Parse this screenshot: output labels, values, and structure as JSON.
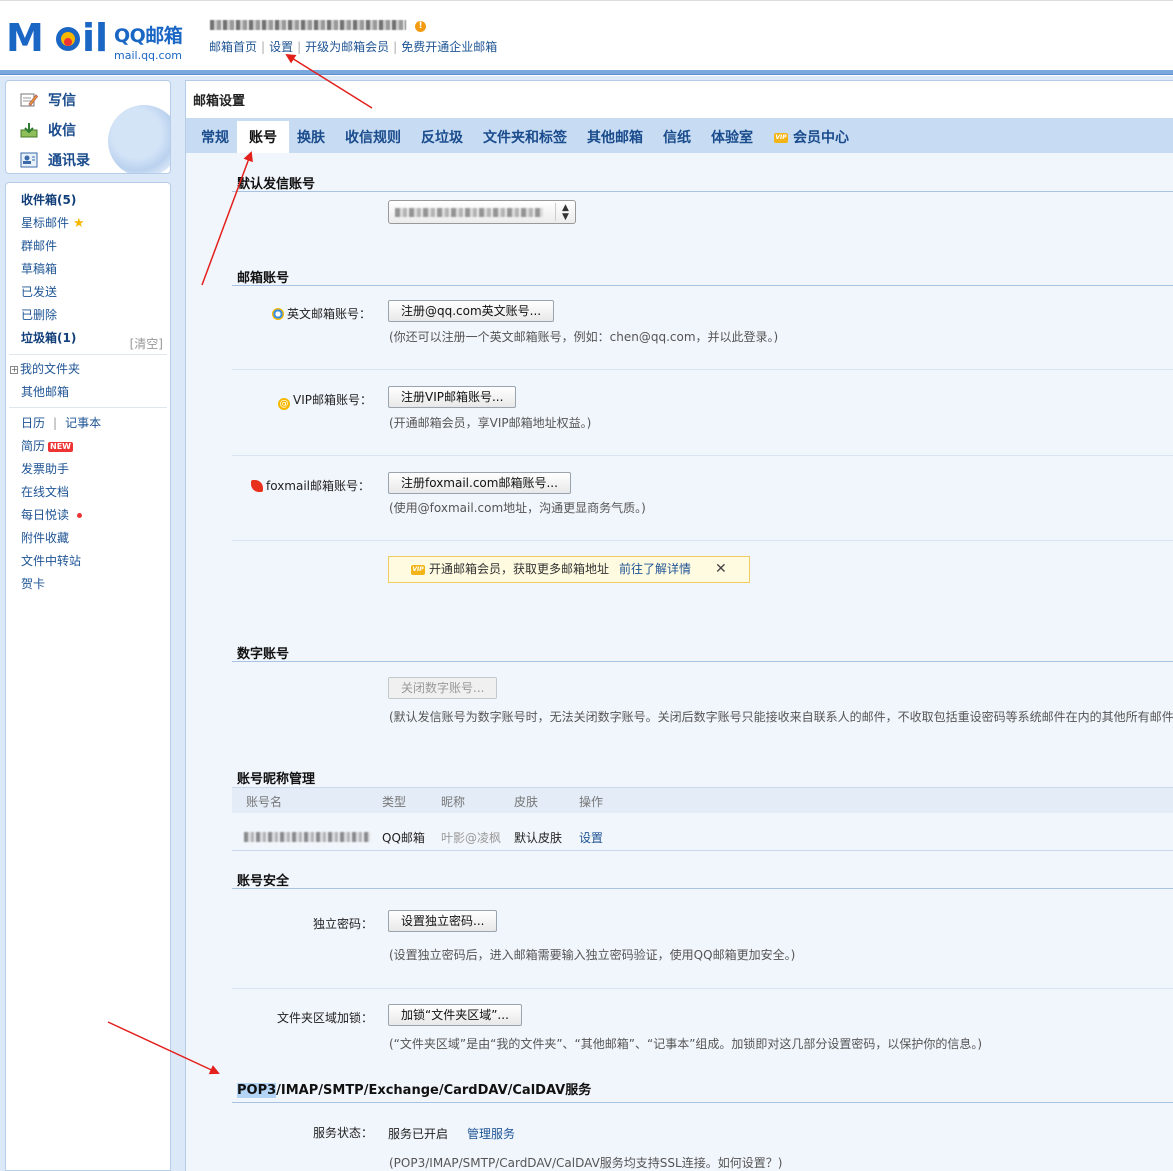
{
  "header": {
    "logo_text": "M●il",
    "logo_cn": "QQ邮箱",
    "logo_en": "mail.qq.com",
    "warn_icon": "!",
    "links": [
      "邮箱首页",
      "设置",
      "开级为邮箱会员",
      "免费开通企业邮箱"
    ]
  },
  "compose": {
    "write": "写信",
    "receive": "收信",
    "contacts": "通讯录"
  },
  "folders": {
    "inbox": "收件箱(5)",
    "starred": "星标邮件",
    "group": "群邮件",
    "drafts": "草稿箱",
    "sent": "已发送",
    "deleted": "已删除",
    "spam": "垃圾箱(1)",
    "spam_clear": "[清空]",
    "my_folders": "我的文件夹",
    "other_mailbox": "其他邮箱",
    "calendar": "日历",
    "notes": "记事本",
    "resume": "简历",
    "new_badge": "NEW",
    "invoice": "发票助手",
    "online_docs": "在线文档",
    "daily_read": "每日悦读",
    "attachments": "附件收藏",
    "file_transfer": "文件中转站",
    "greeting_card": "贺卡"
  },
  "main": {
    "title": "邮箱设置",
    "tabs": [
      "常规",
      "账号",
      "换肤",
      "收信规则",
      "反垃圾",
      "文件夹和标签",
      "其他邮箱",
      "信纸",
      "体验室",
      "会员中心"
    ],
    "active_tab": "账号",
    "vip_icon_text": "VIP"
  },
  "sections": {
    "default_sender": "默认发信账号",
    "mailbox_accounts": "邮箱账号",
    "digital_account": "数字账号",
    "nickname_mgmt": "账号昵称管理",
    "account_security": "账号安全",
    "pop3_prefix": "POP3",
    "pop3_rest": "/IMAP/SMTP/Exchange/CardDAV/CalDAV服务"
  },
  "accounts": {
    "english_label": "英文邮箱账号：",
    "english_btn": "注册@qq.com英文账号...",
    "english_hint": "(你还可以注册一个英文邮箱账号，例如：chen@qq.com，并以此登录。)",
    "vip_label": "VIP邮箱账号：",
    "vip_btn": "注册VIP邮箱账号...",
    "vip_hint": "(开通邮箱会员，享VIP邮箱地址权益。)",
    "foxmail_label": "foxmail邮箱账号：",
    "foxmail_btn": "注册foxmail.com邮箱账号...",
    "foxmail_hint": "(使用@foxmail.com地址，沟通更显商务气质。)",
    "banner_text": "开通邮箱会员，获取更多邮箱地址",
    "banner_link": "前往了解详情",
    "banner_close": "✕"
  },
  "digital": {
    "btn": "关闭数字账号...",
    "hint": "(默认发信账号为数字账号时，无法关闭数字账号。关闭后数字账号只能接收来自联系人的邮件，不收取包括重设密码等系统邮件在内的其他所有邮件。"
  },
  "nickname_table": {
    "headers": [
      "账号名",
      "类型",
      "昵称",
      "皮肤",
      "操作"
    ],
    "row": {
      "type": "QQ邮箱",
      "nickname": "叶影@凌枫",
      "skin": "默认皮肤",
      "action": "设置"
    }
  },
  "security": {
    "pwd_label": "独立密码：",
    "pwd_btn": "设置独立密码...",
    "pwd_hint": "(设置独立密码后，进入邮箱需要输入独立密码验证，使用QQ邮箱更加安全。)",
    "lock_label": "文件夹区域加锁：",
    "lock_btn": "加锁“文件夹区域”...",
    "lock_hint": "(“文件夹区域”是由“我的文件夹”、“其他邮箱”、“记事本”组成。加锁即对这几部分设置密码，以保护你的信息。)"
  },
  "pop3": {
    "status_label": "服务状态：",
    "status_value": "服务已开启",
    "manage_link": "管理服务",
    "hint": "(POP3/IMAP/SMTP/CardDAV/CalDAV服务均支持SSL连接。如何设置？)"
  },
  "colors": {
    "accent_blue": "#1e5494",
    "tab_bar": "#c7dcf3",
    "annotation_red": "#e3201c"
  }
}
